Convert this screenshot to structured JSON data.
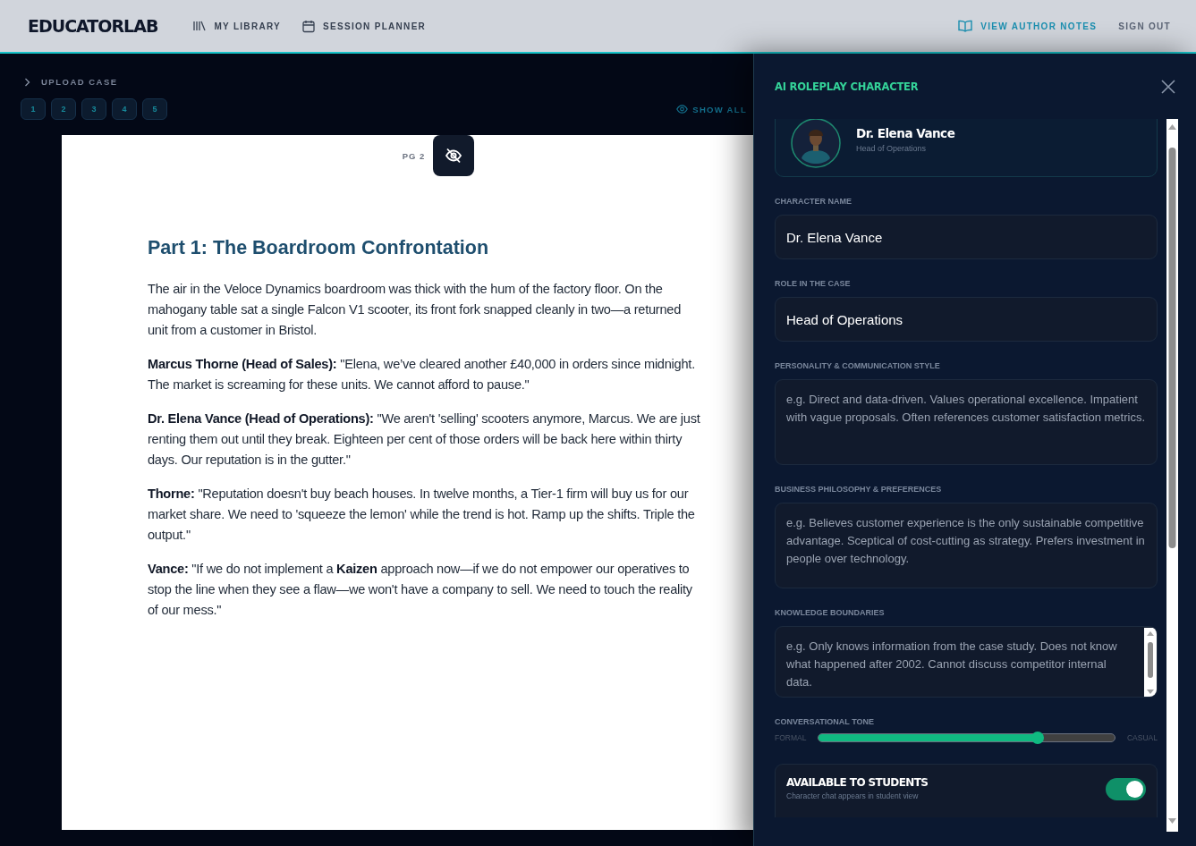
{
  "header": {
    "logo": "EDUCATORLAB",
    "nav": [
      {
        "label": "MY LIBRARY",
        "kind": "library"
      },
      {
        "label": "SESSION PLANNER",
        "kind": "calendar"
      }
    ],
    "author_notes": "VIEW AUTHOR NOTES",
    "sign_out": "SIGN OUT"
  },
  "toolbar": {
    "upload": "UPLOAD CASE",
    "pages": [
      {
        "label": "1",
        "selected": false
      },
      {
        "label": "2",
        "selected": false
      },
      {
        "label": "3",
        "selected": false
      },
      {
        "label": "4",
        "selected": false
      },
      {
        "label": "5",
        "selected": false
      }
    ],
    "show_all": "SHOW ALL"
  },
  "document": {
    "page_label": "PG 2",
    "heading": "Part 1: The Boardroom Confrontation",
    "paragraphs": [
      "The air in the Veloce Dynamics boardroom was thick with the hum of the factory floor. On the mahogany table sat a single Falcon V1 scooter, its front fork snapped cleanly in two—a returned unit from a customer in Bristol.",
      "**Marcus Thorne (Head of Sales):** \"Elena, we’ve cleared another £40,000 in orders since midnight. The market is screaming for these units. We cannot afford to pause.\"",
      "**Dr. Elena Vance (Head of Operations):** \"We aren't 'selling' scooters anymore, Marcus. We are just renting them out until they break. Eighteen per cent of those orders will be back here within thirty days. Our reputation is in the gutter.\"",
      "**Thorne:** \"Reputation doesn't buy beach houses. In twelve months, a Tier-1 firm will buy us for our market share. We need to 'squeeze the lemon' while the trend is hot. Ramp up the shifts. Triple the output.\"",
      "**Vance:** \"If we do not implement a **Kaizen** approach now—if we do not empower our operatives to stop the line when they see a flaw—we won't have a company to sell. We need to touch the reality of our mess.\""
    ]
  },
  "panel": {
    "title": "AI ROLEPLAY CHARACTER",
    "character": {
      "name": "Dr. Elena Vance",
      "role": "Head of Operations"
    },
    "fields": [
      {
        "kind": "input",
        "label": "CHARACTER NAME",
        "value": "Dr. Elena Vance"
      },
      {
        "kind": "input",
        "label": "ROLE IN THE CASE",
        "value": "Head of Operations"
      },
      {
        "kind": "textarea",
        "label": "PERSONALITY & COMMUNICATION STYLE",
        "placeholder": "e.g. Direct and data-driven. Values operational excellence. Impatient with vague proposals. Often references customer satisfaction metrics."
      },
      {
        "kind": "textarea",
        "label": "BUSINESS PHILOSOPHY & PREFERENCES",
        "placeholder": "e.g. Believes customer experience is the only sustainable competitive advantage. Sceptical of cost-cutting as strategy. Prefers investment in people over technology."
      },
      {
        "kind": "textarea-scroll",
        "label": "KNOWLEDGE BOUNDARIES",
        "placeholder": "e.g. Only knows information from the case study. Does not know what happened after 2002. Cannot discuss competitor internal data."
      }
    ],
    "tone": {
      "label": "CONVERSATIONAL TONE",
      "min_label": "FORMAL",
      "max_label": "CASUAL",
      "level": 0.74
    },
    "availability": {
      "title": "AVAILABLE TO STUDENTS",
      "description": "Character chat appears in student view",
      "on": true
    }
  }
}
